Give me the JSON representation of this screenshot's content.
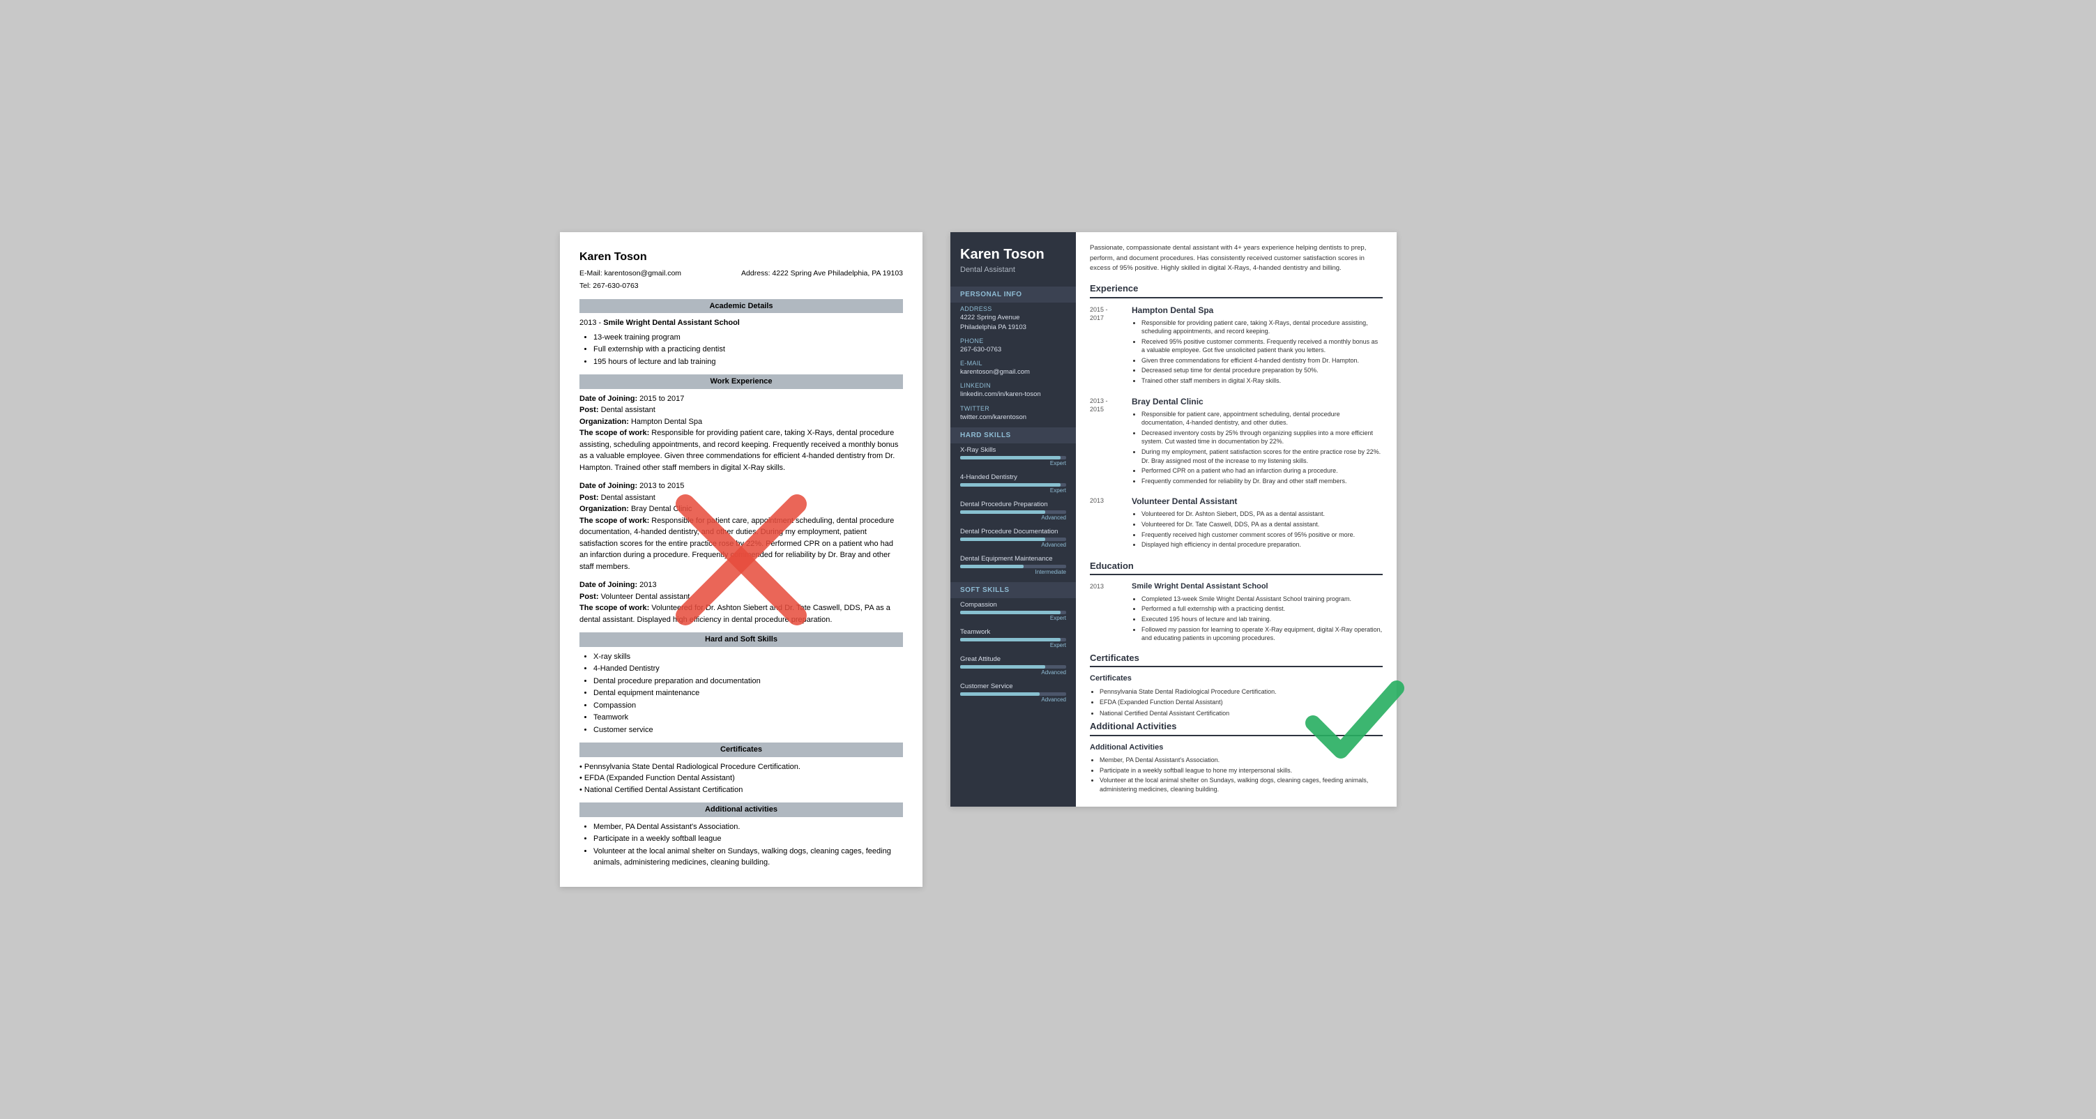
{
  "left_resume": {
    "name": "Karen Toson",
    "email": "E-Mail: karentoson@gmail.com",
    "phone": "Tel: 267-630-0763",
    "address": "Address: 4222 Spring Ave Philadelphia, PA 19103",
    "sections": {
      "academic": {
        "title": "Academic Details",
        "year": "2013 -",
        "school": "Smile Wright Dental Assistant School",
        "bullets": [
          "13-week training program",
          "Full externship with a practicing dentist",
          "195 hours of lecture and lab training"
        ]
      },
      "work": {
        "title": "Work Experience",
        "entries": [
          {
            "dates": "Date of Joining: 2015 to 2017",
            "post": "Post: Dental assistant",
            "org": "Organization: Hampton Dental Spa",
            "scope_label": "The scope of work:",
            "scope": "Responsible for providing patient care, taking X-Rays, dental procedure assisting, scheduling appointments, and record keeping. Frequently received a monthly bonus as a valuable employee. Given three commendations for efficient 4-handed dentistry from Dr. Hampton. Trained other staff members in digital X-Ray skills."
          },
          {
            "dates": "Date of Joining: 2013 to 2015",
            "post": "Post: Dental assistant",
            "org": "Organization: Bray Dental Clinic",
            "scope_label": "The scope of work:",
            "scope": "Responsible for patient care, appointment scheduling, dental procedure documentation, 4-handed dentistry, and other duties. During my employment, patient satisfaction scores for the entire practice rose by 22%. Performed CPR on a patient who had an infarction during a procedure. Frequently commended for reliability by Dr. Bray and other staff members."
          },
          {
            "dates": "Date of Joining: 2013",
            "post": "Post: Volunteer Dental assistant",
            "org": "",
            "scope_label": "The scope of work:",
            "scope": "Volunteered for Dr. Ashton Siebert and Dr. Tate Caswell, DDS, PA as a dental assistant. Displayed high efficiency in dental procedure preparation."
          }
        ]
      },
      "skills": {
        "title": "Hard and Soft Skills",
        "items": [
          "X-ray skills",
          "4-Handed Dentistry",
          "Dental procedure preparation and documentation",
          "Dental equipment maintenance",
          "Compassion",
          "Teamwork",
          "Customer service"
        ]
      },
      "certs": {
        "title": "Certificates",
        "items": [
          "Pennsylvania State Dental Radiological Procedure Certification.",
          "EFDA (Expanded Function Dental Assistant)",
          "National Certified Dental Assistant Certification"
        ]
      },
      "activities": {
        "title": "Additional activities",
        "items": [
          "Member, PA Dental Assistant's Association.",
          "Participate in a weekly softball league",
          "Volunteer at the local animal shelter on Sundays, walking dogs, cleaning cages, feeding animals, administering medicines, cleaning building."
        ]
      }
    }
  },
  "right_resume": {
    "name": "Karen Toson",
    "title": "Dental Assistant",
    "summary": "Passionate, compassionate dental assistant with 4+ years experience helping dentists to prep, perform, and document procedures. Has consistently received customer satisfaction scores in excess of 95% positive. Highly skilled in digital X-Rays, 4-handed dentistry and billing.",
    "sidebar": {
      "personal_info_title": "Personal Info",
      "address_label": "Address",
      "address_value": "4222 Spring Avenue\nPhiladelphia PA 19103",
      "phone_label": "Phone",
      "phone_value": "267-630-0763",
      "email_label": "E-mail",
      "email_value": "karentoson@gmail.com",
      "linkedin_label": "LinkedIn",
      "linkedin_value": "linkedin.com/in/karen-toson",
      "twitter_label": "Twitter",
      "twitter_value": "twitter.com/karentoson",
      "hard_skills_title": "Hard Skills",
      "hard_skills": [
        {
          "name": "X-Ray Skills",
          "level": "Expert",
          "pct": 95
        },
        {
          "name": "4-Handed Dentistry",
          "level": "Expert",
          "pct": 95
        },
        {
          "name": "Dental Procedure Preparation",
          "level": "Advanced",
          "pct": 80
        },
        {
          "name": "Dental Procedure Documentation",
          "level": "Advanced",
          "pct": 80
        },
        {
          "name": "Dental Equipment Maintenance",
          "level": "Intermediate",
          "pct": 60
        }
      ],
      "soft_skills_title": "Soft Skills",
      "soft_skills": [
        {
          "name": "Compassion",
          "level": "Expert",
          "pct": 95
        },
        {
          "name": "Teamwork",
          "level": "Expert",
          "pct": 95
        },
        {
          "name": "Great Attitude",
          "level": "Advanced",
          "pct": 80
        },
        {
          "name": "Customer Service",
          "level": "Advanced",
          "pct": 75
        }
      ]
    },
    "experience_title": "Experience",
    "experience": [
      {
        "dates": "2015 -\n2017",
        "company": "Hampton Dental Spa",
        "bullets": [
          "Responsible for providing patient care, taking X-Rays, dental procedure assisting, scheduling appointments, and record keeping.",
          "Received 95% positive customer comments. Frequently received a monthly bonus as a valuable employee. Got five unsolicited patient thank you letters.",
          "Given three commendations for efficient 4-handed dentistry from Dr. Hampton.",
          "Decreased setup time for dental procedure preparation by 50%.",
          "Trained other staff members in digital X-Ray skills."
        ]
      },
      {
        "dates": "2013 -\n2015",
        "company": "Bray Dental Clinic",
        "bullets": [
          "Responsible for patient care, appointment scheduling, dental procedure documentation, 4-handed dentistry, and other duties.",
          "Decreased inventory costs by 25% through organizing supplies into a more efficient system. Cut wasted time in documentation by 22%.",
          "During my employment, patient satisfaction scores for the entire practice rose by 22%. Dr. Bray assigned most of the increase to my listening skills.",
          "Performed CPR on a patient who had an infarction during a procedure.",
          "Frequently commended for reliability by Dr. Bray and other staff members."
        ]
      },
      {
        "dates": "2013",
        "company": "Volunteer Dental Assistant",
        "bullets": [
          "Volunteered for Dr. Ashton Siebert, DDS, PA as a dental assistant.",
          "Volunteered for Dr. Tate Caswell, DDS, PA as a dental assistant.",
          "Frequently received high customer comment scores of 95% positive or more.",
          "Displayed high efficiency in dental procedure preparation."
        ]
      }
    ],
    "education_title": "Education",
    "education": [
      {
        "date": "2013",
        "school": "Smile Wright Dental Assistant School",
        "bullets": [
          "Completed 13-week Smile Wright Dental Assistant School training program.",
          "Performed a full externship with a practicing dentist.",
          "Executed 195 hours of lecture and lab training.",
          "Followed my passion for learning to operate X-Ray equipment, digital X-Ray operation, and educating patients in upcoming procedures."
        ]
      }
    ],
    "certs_title": "Certificates",
    "certs_subtitle": "Certificates",
    "certs": [
      "Pennsylvania State Dental Radiological Procedure Certification.",
      "EFDA (Expanded Function Dental Assistant)",
      "National Certified Dental Assistant Certification"
    ],
    "activities_title": "Additional Activities",
    "activities_subtitle": "Additional Activities",
    "activities": [
      "Member, PA Dental Assistant's Association.",
      "Participate in a weekly softball league to hone my interpersonal skills.",
      "Volunteer at the local animal shelter on Sundays, walking dogs, cleaning cages, feeding animals, administering medicines, cleaning building."
    ]
  }
}
